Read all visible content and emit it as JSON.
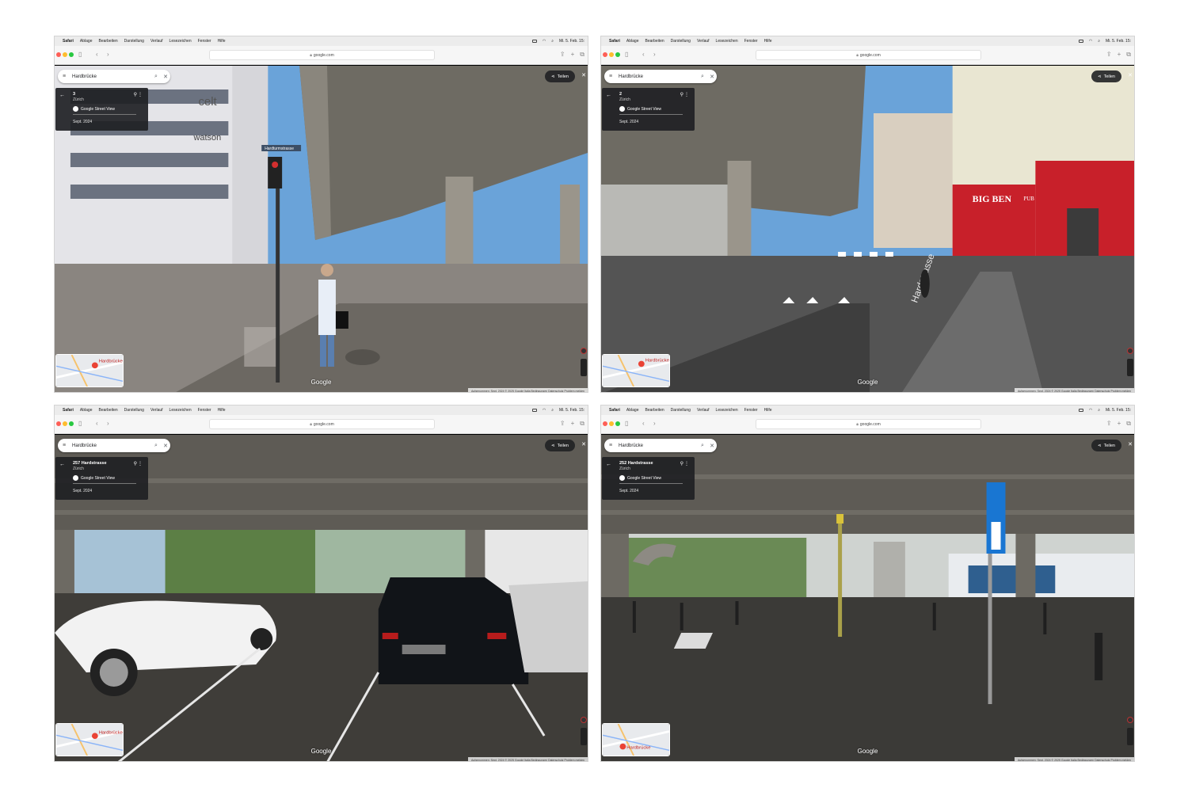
{
  "menubar": {
    "apple": "",
    "items": [
      "Safari",
      "Ablage",
      "Bearbeiten",
      "Darstellung",
      "Verlauf",
      "Lesezeichen",
      "Fenster",
      "Hilfe"
    ],
    "datetime": "Mi. 5. Feb. 15:"
  },
  "browser": {
    "url": "google.com"
  },
  "maps": {
    "search_query": "Hardbrücke",
    "service_label": "Google Street View",
    "date": "Sept. 2024",
    "share_label": "Teilen",
    "google_logo": "Google",
    "attribution": "Aufgenommen: Sept. 2024   © 2025 Google   Italia   Bedingungen   Datenschutz   Problem melden",
    "minimap_label": "Hardbrücke"
  },
  "screenshots": [
    {
      "title": "3",
      "city": "Zürich"
    },
    {
      "title": "2",
      "city": "Zürich"
    },
    {
      "title": "257 Hardstrasse",
      "city": "Zürich"
    },
    {
      "title": "252 Hardstrasse",
      "city": "Zürich"
    }
  ],
  "scene_text": {
    "street_sign": "Hardturmstrasse",
    "building_sign_1": "celt",
    "building_sign_2": "watson",
    "pub_sign": "BIG BEN",
    "pub_sign_2": "PUB",
    "road_marking": "Hardstrasse"
  },
  "colors": {
    "sky": "#6aa3d9",
    "concrete": "#7d7a72",
    "road": "#545454",
    "pub_red": "#c8202a",
    "pin_red": "#ea4335"
  }
}
